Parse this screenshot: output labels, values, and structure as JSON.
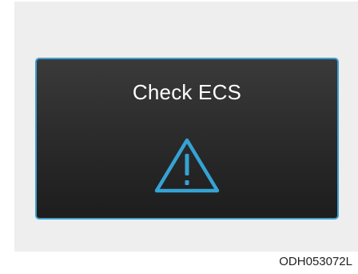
{
  "display": {
    "message": "Check ECS",
    "icon": "warning-triangle-icon",
    "border_color": "#3f9fcf",
    "icon_color": "#35a3d4"
  },
  "caption": "ODH053072L"
}
